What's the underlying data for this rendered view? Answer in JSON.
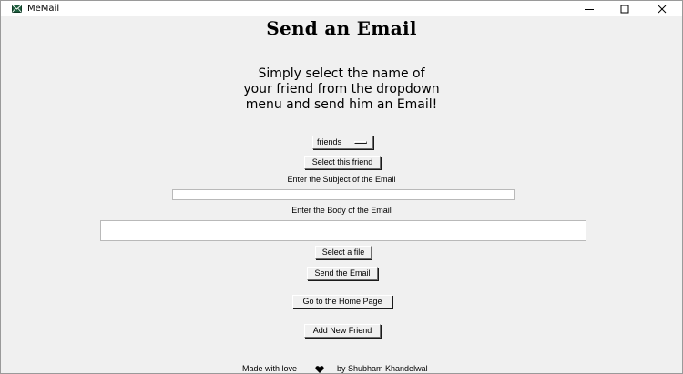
{
  "window": {
    "title": "MeMail",
    "app_icon": "envelope-icon",
    "controls": {
      "minimize": "minimize-icon",
      "maximize": "maximize-icon",
      "close": "close-icon"
    }
  },
  "main": {
    "heading": "Send an Email",
    "subtitle": "Simply select the name of\nyour friend from the dropdown\nmenu and send him an Email!",
    "friend_menu": {
      "selected": "friends",
      "indicator": "option-menu-indicator"
    },
    "select_friend_label": "Select this friend",
    "subject_label": "Enter the Subject of the Email",
    "subject_value": "",
    "body_label": "Enter the Body of the Email",
    "body_value": "",
    "select_file_label": "Select a file",
    "send_label": "Send the Email",
    "home_label": "Go to the Home Page",
    "add_friend_label": "Add New Friend"
  },
  "footer": {
    "made_with": "Made with love",
    "heart": "heart-icon",
    "author": "by Shubham Khandelwal"
  },
  "colors": {
    "window_bg": "#f0f0f0",
    "titlebar_bg": "#ffffff",
    "app_icon": "#1f5f3f",
    "entry_bg": "#ffffff"
  }
}
